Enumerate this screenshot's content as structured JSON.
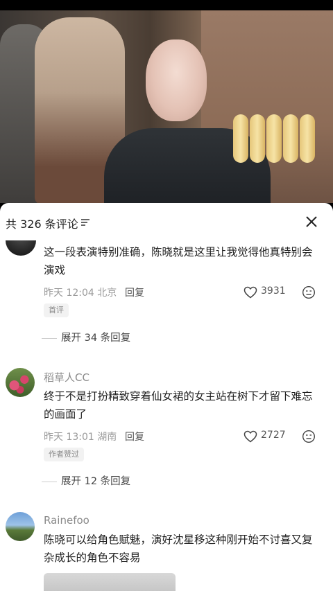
{
  "header": {
    "comment_count_label": "共 326 条评论"
  },
  "comments": [
    {
      "text": "这一段表演特别准确，陈晓就是这里让我觉得他真特别会演戏",
      "time": "昨天 12:04 北京",
      "reply_label": "回复",
      "likes": "3931",
      "badge": "首评",
      "expand_label": "展开 34 条回复"
    },
    {
      "username": "稻草人CC",
      "text": "终于不是打扮精致穿着仙女裙的女主站在树下才留下难忘的画面了",
      "time": "昨天 13:01 湖南",
      "reply_label": "回复",
      "likes": "2727",
      "badge": "作者赞过",
      "expand_label": "展开 12 条回复"
    },
    {
      "username": "Rainefoo",
      "text": "陈晓可以给角色赋魅，演好沈星移这种刚开始不讨喜又复杂成长的角色不容易"
    }
  ],
  "icons": {
    "sort": "sort-icon",
    "close": "close-icon",
    "like": "heart-icon",
    "dislike": "dislike-face-icon"
  }
}
